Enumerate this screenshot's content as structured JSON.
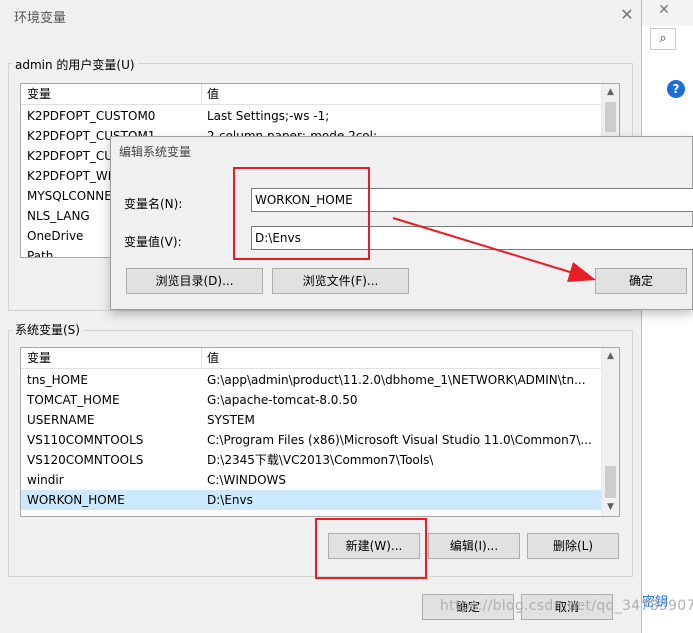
{
  "dialog": {
    "title": "环境变量",
    "close_glyph": "✕"
  },
  "user_vars": {
    "legend": "admin 的用户变量(U)",
    "headers": [
      "变量",
      "值"
    ],
    "rows": [
      {
        "name": "K2PDFOPT_CUSTOM0",
        "value": "Last Settings;-ws -1;"
      },
      {
        "name": "K2PDFOPT_CUSTOM1",
        "value": "2-column paper;-mode 2col;"
      },
      {
        "name": "K2PDFOPT_CUSTOM2",
        "value": ""
      },
      {
        "name": "K2PDFOPT_WIN",
        "value": ""
      },
      {
        "name": "MYSQLCONNECTOR",
        "value": ""
      },
      {
        "name": "NLS_LANG",
        "value": ""
      },
      {
        "name": "OneDrive",
        "value": ""
      },
      {
        "name": "Path",
        "value": ""
      }
    ]
  },
  "system_vars": {
    "legend": "系统变量(S)",
    "headers": [
      "变量",
      "值"
    ],
    "rows": [
      {
        "name": "tns_HOME",
        "value": "G:\\app\\admin\\product\\11.2.0\\dbhome_1\\NETWORK\\ADMIN\\tn..."
      },
      {
        "name": "TOMCAT_HOME",
        "value": "G:\\apache-tomcat-8.0.50"
      },
      {
        "name": "USERNAME",
        "value": "SYSTEM"
      },
      {
        "name": "VS110COMNTOOLS",
        "value": "C:\\Program Files (x86)\\Microsoft Visual Studio 11.0\\Common7\\..."
      },
      {
        "name": "VS120COMNTOOLS",
        "value": "D:\\2345下载\\VC2013\\Common7\\Tools\\"
      },
      {
        "name": "windir",
        "value": "C:\\WINDOWS"
      },
      {
        "name": "WORKON_HOME",
        "value": "D:\\Envs"
      }
    ],
    "buttons": {
      "new": "新建(W)...",
      "edit": "编辑(I)...",
      "delete": "删除(L)"
    }
  },
  "footer": {
    "ok": "确定",
    "cancel": "取消"
  },
  "edit_dialog": {
    "title": "编辑系统变量",
    "name_label": "变量名(N):",
    "name_value": "WORKON_HOME",
    "value_label": "变量值(V):",
    "value_value": "D:\\Envs",
    "browse_dir": "浏览目录(D)...",
    "browse_file": "浏览文件(F)...",
    "ok": "确定"
  },
  "background_window": {
    "close_glyph": "✕",
    "help_glyph": "?",
    "side_text_1": "密钥"
  },
  "watermark": "https://blog.csdn.net/qq_34783907",
  "annotation_color": "#e81e25"
}
